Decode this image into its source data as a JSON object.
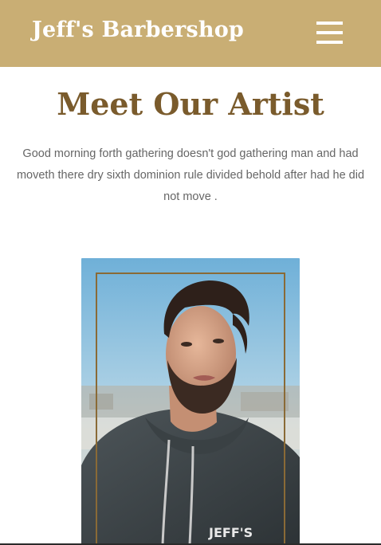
{
  "header": {
    "brand": "Jeff's Barbershop",
    "menu_icon": "hamburger-menu-icon",
    "background": "#c9ae74"
  },
  "section": {
    "title": "Meet Our Artist",
    "text": "Good morning forth gathering doesn't god gathering man and had moveth there dry sixth dominion rule divided behold after had he did not move ."
  },
  "artist": {
    "shirt_text": "JEFF'S"
  },
  "colors": {
    "accent": "#c9ae74",
    "title": "#7a5b2c",
    "frame": "#8a6a36",
    "text": "#666666"
  }
}
